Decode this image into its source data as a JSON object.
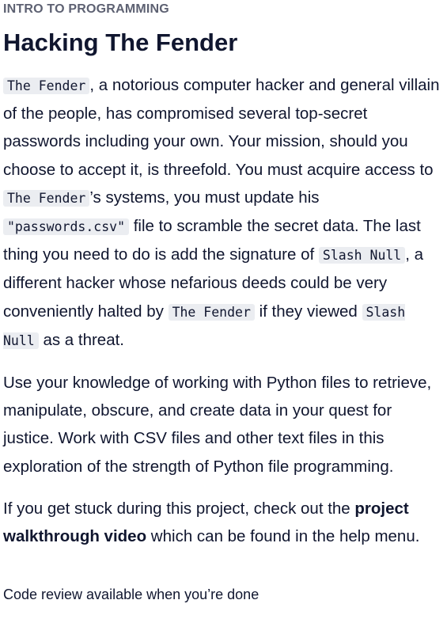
{
  "eyebrow": "INTRO TO PROGRAMMING",
  "title": "Hacking The Fender",
  "para1": {
    "code_fender": "The Fender",
    "t1": ", a notorious computer hacker and general villain of the people, has compromised several top-secret passwords including your own. Your mission, should you choose to accept it, is threefold. You must acquire access to ",
    "t2": "’s systems, you must update his ",
    "code_passwords": "\"passwords.csv\"",
    "t3": " file to scramble the secret data. The last thing you need to do is add the signature of ",
    "code_slash_null": "Slash Null",
    "t4": ", a different hacker whose nefarious deeds could be very conveniently halted by ",
    "t5": " if they viewed ",
    "t6": " as a threat."
  },
  "para2": "Use your knowledge of working with Python files to retrieve, manipulate, obscure, and create data in your quest for justice. Work with CSV files and other text files in this exploration of the strength of Python file programming.",
  "para3": {
    "t1": "If you get stuck during this project, check out the ",
    "bold": "project walkthrough video",
    "t2": " which can be found in the help menu."
  },
  "note": "Code review available when you’re done"
}
